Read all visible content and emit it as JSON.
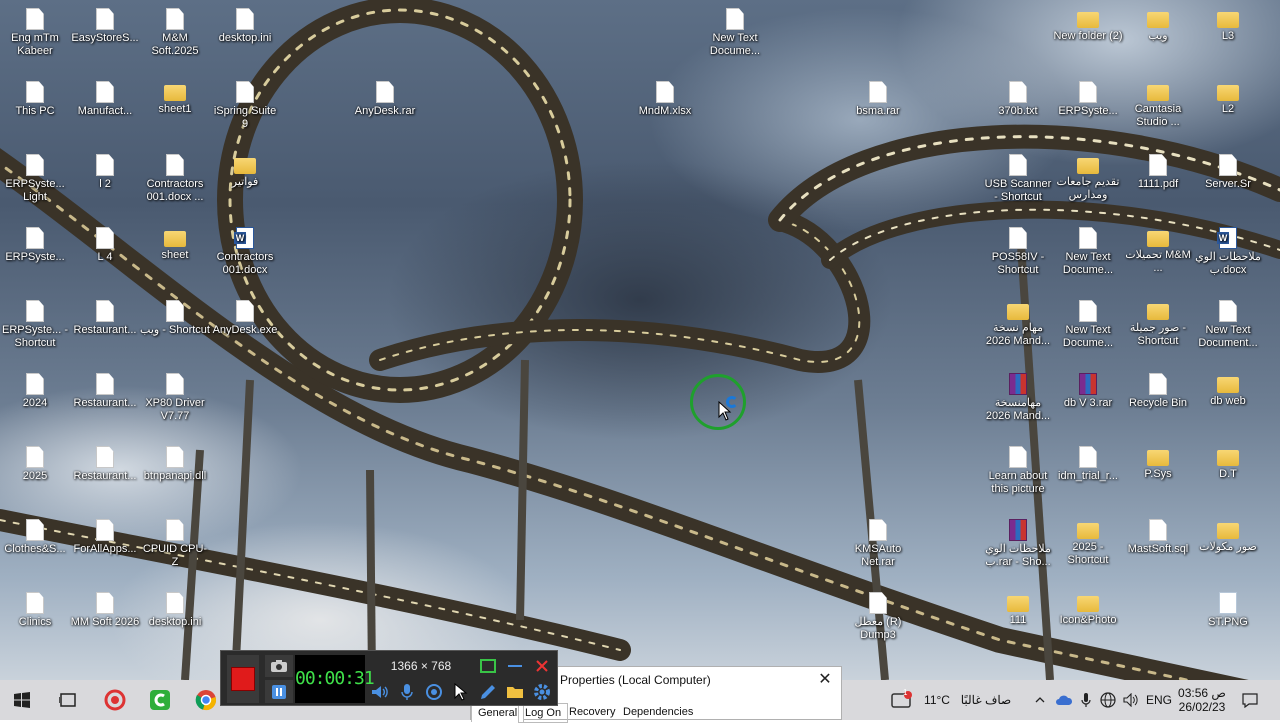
{
  "desktop_icons": [
    {
      "label": "Eng mTm Kabeer",
      "type": "file"
    },
    {
      "label": "EasyStoreS...",
      "type": "file"
    },
    {
      "label": "M&M Soft.2025",
      "type": "file"
    },
    {
      "label": "desktop.ini",
      "type": "file"
    },
    {
      "label": "New Text Docume...",
      "type": "file"
    },
    {
      "label": "New folder (2)",
      "type": "folder"
    },
    {
      "label": "ويب",
      "type": "folder"
    },
    {
      "label": "L3",
      "type": "folder"
    },
    {
      "label": "This PC",
      "type": "file"
    },
    {
      "label": "Manufact...",
      "type": "file"
    },
    {
      "label": "sheet1",
      "type": "folder"
    },
    {
      "label": "iSpring Suite 9",
      "type": "file"
    },
    {
      "label": "AnyDesk.rar",
      "type": "file"
    },
    {
      "label": "MndM.xlsx",
      "type": "file"
    },
    {
      "label": "bsma.rar",
      "type": "file"
    },
    {
      "label": "370b.txt",
      "type": "file"
    },
    {
      "label": "ERPSyste...",
      "type": "file"
    },
    {
      "label": "Camtasia Studio ...",
      "type": "folder"
    },
    {
      "label": "L2",
      "type": "folder"
    },
    {
      "label": "ERPSyste... Light",
      "type": "file"
    },
    {
      "label": "l 2",
      "type": "file"
    },
    {
      "label": "Contractors 001.docx ...",
      "type": "file"
    },
    {
      "label": "فواتير",
      "type": "folder"
    },
    {
      "label": "USB Scanner - Shortcut",
      "type": "file"
    },
    {
      "label": "تقديم جامعات ومدارس",
      "type": "folder"
    },
    {
      "label": "1111.pdf",
      "type": "file"
    },
    {
      "label": "Server.Sr",
      "type": "file"
    },
    {
      "label": "ERPSyste...",
      "type": "file"
    },
    {
      "label": "L 4",
      "type": "file"
    },
    {
      "label": "sheet",
      "type": "folder"
    },
    {
      "label": "Contractors 001.docx",
      "type": "word"
    },
    {
      "label": "POS58IV - Shortcut",
      "type": "file"
    },
    {
      "label": "New Text Docume...",
      "type": "file"
    },
    {
      "label": "تحميلات M&M ...",
      "type": "folder"
    },
    {
      "label": "ملاحظات الوي ب.docx",
      "type": "word"
    },
    {
      "label": "ERPSyste... - Shortcut",
      "type": "file"
    },
    {
      "label": "Restaurant...",
      "type": "file"
    },
    {
      "label": "ويب - Shortcut",
      "type": "file"
    },
    {
      "label": "AnyDesk.exe",
      "type": "file"
    },
    {
      "label": "مهام نسخة 2026 Mand...",
      "type": "folder"
    },
    {
      "label": "New Text Docume...",
      "type": "file"
    },
    {
      "label": "صور جميلة - Shortcut",
      "type": "folder"
    },
    {
      "label": "New Text Document...",
      "type": "file"
    },
    {
      "label": "2024",
      "type": "file"
    },
    {
      "label": "Restaurant...",
      "type": "file"
    },
    {
      "label": "XP80 Driver V7.77",
      "type": "file"
    },
    {
      "label": "مهامنسخة 2026 Mand...",
      "type": "rar"
    },
    {
      "label": "db V 3.rar",
      "type": "rar"
    },
    {
      "label": "Recycle Bin",
      "type": "file"
    },
    {
      "label": "db web",
      "type": "folder"
    },
    {
      "label": "2025",
      "type": "file"
    },
    {
      "label": "Restaurant...",
      "type": "file"
    },
    {
      "label": "btnpanapi.dll",
      "type": "file"
    },
    {
      "label": "Learn about this picture",
      "type": "file"
    },
    {
      "label": "idm_trial_r...",
      "type": "file"
    },
    {
      "label": "P.Sys",
      "type": "folder"
    },
    {
      "label": "D.T",
      "type": "folder"
    },
    {
      "label": "Clothes&S...",
      "type": "file"
    },
    {
      "label": "ForAllApps...",
      "type": "file"
    },
    {
      "label": "CPUID CPU-Z",
      "type": "file"
    },
    {
      "label": "KMSAuto Net.rar",
      "type": "file"
    },
    {
      "label": "ملاحظات الوي ب.rar - Sho...",
      "type": "rar"
    },
    {
      "label": "2025 - Shortcut",
      "type": "folder"
    },
    {
      "label": "MastSoft.sql",
      "type": "file"
    },
    {
      "label": "صور مكولات",
      "type": "folder"
    },
    {
      "label": "Clinics",
      "type": "file"
    },
    {
      "label": "MM Soft 2026",
      "type": "file"
    },
    {
      "label": "desktop.ini",
      "type": "file"
    },
    {
      "label": "معطل (R) Dump3",
      "type": "file"
    },
    {
      "label": "111",
      "type": "folder"
    },
    {
      "label": "Icon&Photo",
      "type": "folder"
    },
    {
      "label": "ST.PNG",
      "type": "png"
    }
  ],
  "recorder": {
    "timer": "00:00:31",
    "resolution": "1366 × 768"
  },
  "properties_window": {
    "title": "Properties (Local Computer)",
    "close": "✕",
    "tabs": [
      "General",
      "Log On",
      "Recovery",
      "Dependencies"
    ]
  },
  "taskbar": {
    "weather_temp": "11°C",
    "weather_text": "صاف غالبًا",
    "language": "ENG",
    "time": "03:56 ص",
    "date": "26/02/23",
    "weather_badge": "1"
  },
  "colors": {
    "record_red": "#e01b1b",
    "timer_green": "#3fe04a",
    "busy_ring": "#1fa02d",
    "taskbar_bg": "#d9d9dc"
  }
}
